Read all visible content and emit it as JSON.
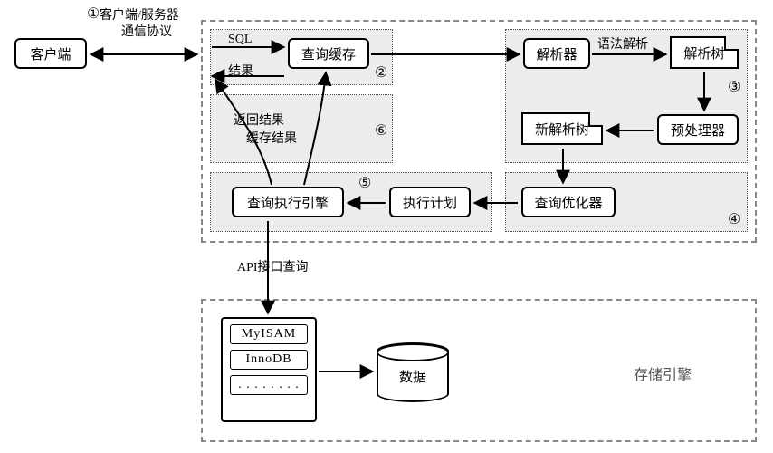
{
  "nodes": {
    "client": "客户端",
    "query_cache": "查询缓存",
    "parser": "解析器",
    "parse_tree": "解析树",
    "preprocessor": "预处理器",
    "new_parse_tree": "新解析树",
    "query_optimizer": "查询优化器",
    "execution_plan": "执行计划",
    "query_engine": "查询执行引擎",
    "data_cylinder": "数据",
    "storage_label": "存储引擎"
  },
  "engines": {
    "row1": "MyISAM",
    "row2": "InnoDB",
    "row3": ". . . . . . . ."
  },
  "edges": {
    "protocol_line1": "客户端/服务器",
    "protocol_line2": "通信协议",
    "sql": "SQL",
    "result": "结果",
    "syntax_parse": "语法解析",
    "return_result": "返回结果",
    "cache_result": "缓存结果",
    "api_query": "API接口查询"
  },
  "markers": {
    "m1": "①",
    "m2": "②",
    "m3": "③",
    "m4": "④",
    "m5": "⑤",
    "m6": "⑥"
  }
}
